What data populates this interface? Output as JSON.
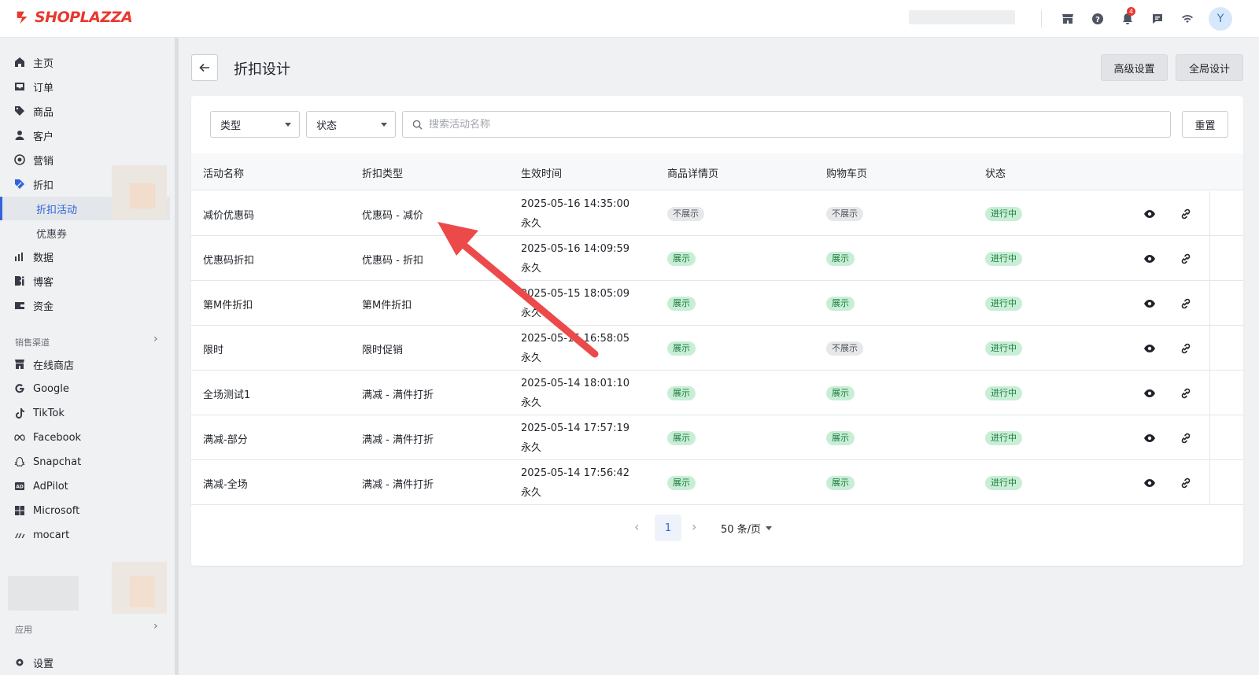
{
  "brand": {
    "name": "SHOPLAZZA",
    "color": "#e8382f"
  },
  "topbar": {
    "icons": [
      "store-icon",
      "help-icon",
      "bell-icon",
      "chat-icon",
      "wifi-icon"
    ],
    "notification_count": "4",
    "avatar_initial": "Y"
  },
  "sidebar": {
    "items": [
      {
        "label": "主页",
        "icon": "home-icon"
      },
      {
        "label": "订单",
        "icon": "inbox-icon"
      },
      {
        "label": "商品",
        "icon": "tag-icon"
      },
      {
        "label": "客户",
        "icon": "person-icon"
      },
      {
        "label": "营销",
        "icon": "target-icon"
      },
      {
        "label": "折扣",
        "icon": "discount-icon"
      }
    ],
    "sub_items": [
      {
        "label": "折扣活动",
        "active": true
      },
      {
        "label": "优惠券",
        "active": false
      }
    ],
    "items2": [
      {
        "label": "数据",
        "icon": "bar-chart-icon"
      },
      {
        "label": "博客",
        "icon": "blog-icon"
      },
      {
        "label": "资金",
        "icon": "wallet-icon"
      }
    ],
    "channels_label": "销售渠道",
    "channels": [
      {
        "label": "在线商店",
        "icon": "store-icon"
      },
      {
        "label": "Google",
        "icon": "google-icon"
      },
      {
        "label": "TikTok",
        "icon": "tiktok-icon"
      },
      {
        "label": "Facebook",
        "icon": "meta-icon"
      },
      {
        "label": "Snapchat",
        "icon": "ghost-icon"
      },
      {
        "label": "AdPilot",
        "icon": "ad-icon"
      },
      {
        "label": "Microsoft",
        "icon": "windows-icon"
      },
      {
        "label": "mocart",
        "icon": "mocart-icon"
      }
    ],
    "apps_label": "应用",
    "settings_label": "设置"
  },
  "page": {
    "title": "折扣设计",
    "advanced_button": "高级设置",
    "global_button": "全局设计"
  },
  "filters": {
    "type_label": "类型",
    "status_label": "状态",
    "search_placeholder": "搜索活动名称",
    "reset_label": "重置"
  },
  "table": {
    "headers": [
      "活动名称",
      "折扣类型",
      "生效时间",
      "商品详情页",
      "购物车页",
      "状态"
    ],
    "rows": [
      {
        "name": "减价优惠码",
        "type": "优惠码 - 减价",
        "time": "2025-05-16 14:35:00",
        "duration": "永久",
        "detail": "不展示",
        "cart": "不展示",
        "status": "进行中"
      },
      {
        "name": "优惠码折扣",
        "type": "优惠码 - 折扣",
        "time": "2025-05-16 14:09:59",
        "duration": "永久",
        "detail": "展示",
        "cart": "展示",
        "status": "进行中"
      },
      {
        "name": "第M件折扣",
        "type": "第M件折扣",
        "time": "2025-05-15 18:05:09",
        "duration": "永久",
        "detail": "展示",
        "cart": "展示",
        "status": "进行中"
      },
      {
        "name": "限时",
        "type": "限时促销",
        "time": "2025-05-15 16:58:05",
        "duration": "永久",
        "detail": "展示",
        "cart": "不展示",
        "status": "进行中"
      },
      {
        "name": "全场测试1",
        "type": "满减 - 满件打折",
        "time": "2025-05-14 18:01:10",
        "duration": "永久",
        "detail": "展示",
        "cart": "展示",
        "status": "进行中"
      },
      {
        "name": "满减-部分",
        "type": "满减 - 满件打折",
        "time": "2025-05-14 17:57:19",
        "duration": "永久",
        "detail": "展示",
        "cart": "展示",
        "status": "进行中"
      },
      {
        "name": "满减-全场",
        "type": "满减 - 满件打折",
        "time": "2025-05-14 17:56:42",
        "duration": "永久",
        "detail": "展示",
        "cart": "展示",
        "status": "进行中"
      }
    ]
  },
  "pagination": {
    "current_page": "1",
    "page_size": "50 条/页"
  },
  "colors": {
    "accent": "#2f65d9",
    "badge_green_bg": "#c8efd6",
    "badge_gray_bg": "#e7e8ea",
    "annotation_arrow": "#ec4a4a"
  }
}
